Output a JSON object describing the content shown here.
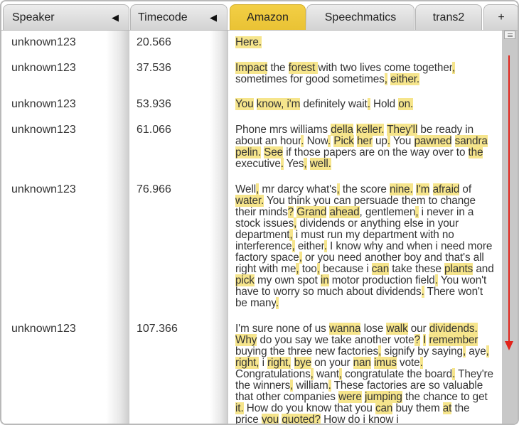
{
  "tabs": {
    "speaker": "Speaker",
    "sort_icon": "◀",
    "timecode": "Timecode",
    "amazon": "Amazon",
    "speechmatics": "Speechmatics",
    "trans2": "trans2",
    "add": "+"
  },
  "colors": {
    "active_tab": "#f0c93c",
    "highlight": "#f6e58c",
    "arrow": "#e2231a"
  },
  "rows": [
    {
      "speaker": "unknown123",
      "time": "20.566"
    },
    {
      "speaker": "unknown123",
      "time": "37.536"
    },
    {
      "speaker": "unknown123",
      "time": "53.936"
    },
    {
      "speaker": "unknown123",
      "time": "61.066"
    },
    {
      "speaker": "unknown123",
      "time": "76.966"
    },
    {
      "speaker": "unknown123",
      "time": "107.366"
    }
  ],
  "transcripts": [
    "Here.",
    "Impact the forest with two lives come together, sometimes for good sometimes, either.",
    "You know, i'm definitely wait. Hold on.",
    "Phone mrs williams della keller. They'll be ready in about an hour. Now. Pick her up. You pawned sandra pelin. See if those papers are on the way over to the executive. Yes, well.",
    "Well, mr darcy what's, the score nine. I'm afraid of water. You think you can persuade them to change their minds? Grand ahead, gentlemen, i never in a stock issues, dividends or anything else in your department, i must run my department with no interference, either. I know why and when i need more factory space, or you need another boy and that's all right with me, too, because i can take these plants and pick my own spot in motor production field. You won't have to worry so much about dividends. There won't be many.",
    "I'm sure none of us wanna lose walk our dividends. Why do you say we take another vote? I remember buying the three new factories, signify by saying, aye, right, i right, bye on your nan imus vote. Congratulations, want, congratulate the board. They're the winners, william. These factories are so valuable that other companies were jumping the chance to get it. How do you know that you can buy them at the price you quoted? How do i know i"
  ],
  "transcript_words": [
    [
      {
        "t": "Here.",
        "h": true
      }
    ],
    [
      {
        "t": "Impact",
        "h": true
      },
      {
        "t": " the "
      },
      {
        "t": "forest ",
        "h": true
      },
      {
        "t": " with two lives come together"
      },
      {
        "t": ",",
        "h": true
      },
      {
        "t": " sometimes for good sometimes"
      },
      {
        "t": ",",
        "h": true
      },
      {
        "t": " "
      },
      {
        "t": "either.",
        "h": true
      }
    ],
    [
      {
        "t": "You",
        "h": true
      },
      {
        "t": " "
      },
      {
        "t": "know",
        "h": true
      },
      {
        "t": ", ",
        "h": true
      },
      {
        "t": "i'm",
        "h": true
      },
      {
        "t": " definitely wait"
      },
      {
        "t": ".",
        "h": true
      },
      {
        "t": " Hold "
      },
      {
        "t": "on.",
        "h": true
      }
    ],
    [
      {
        "t": "Phone mrs williams "
      },
      {
        "t": "della",
        "h": true
      },
      {
        "t": " "
      },
      {
        "t": "keller.",
        "h": true
      },
      {
        "t": " "
      },
      {
        "t": "They'll",
        "h": true
      },
      {
        "t": " be ready in about an hour"
      },
      {
        "t": ".",
        "h": true
      },
      {
        "t": " Now"
      },
      {
        "t": ".",
        "h": true
      },
      {
        "t": " "
      },
      {
        "t": "Pick",
        "h": true
      },
      {
        "t": " "
      },
      {
        "t": "her",
        "h": true
      },
      {
        "t": " up"
      },
      {
        "t": ".",
        "h": true
      },
      {
        "t": " You "
      },
      {
        "t": "pawned",
        "h": true
      },
      {
        "t": " "
      },
      {
        "t": "sandra",
        "h": true
      },
      {
        "t": " "
      },
      {
        "t": "pelin.",
        "h": true
      },
      {
        "t": " "
      },
      {
        "t": "See",
        "h": true
      },
      {
        "t": " if those papers are on the way over to "
      },
      {
        "t": "the",
        "h": true
      },
      {
        "t": " executive"
      },
      {
        "t": ".",
        "h": true
      },
      {
        "t": " Yes"
      },
      {
        "t": ",",
        "h": true
      },
      {
        "t": " "
      },
      {
        "t": "well.",
        "h": true
      }
    ],
    [
      {
        "t": "Well"
      },
      {
        "t": ",",
        "h": true
      },
      {
        "t": " mr darcy what's"
      },
      {
        "t": ",",
        "h": true
      },
      {
        "t": " the score "
      },
      {
        "t": "nine.",
        "h": true
      },
      {
        "t": " "
      },
      {
        "t": "I'm",
        "h": true
      },
      {
        "t": " "
      },
      {
        "t": "afraid",
        "h": true
      },
      {
        "t": " of "
      },
      {
        "t": "water.",
        "h": true
      },
      {
        "t": " You think you can persuade them to change their minds"
      },
      {
        "t": "?",
        "h": true
      },
      {
        "t": " "
      },
      {
        "t": "Grand",
        "h": true
      },
      {
        "t": " "
      },
      {
        "t": "ahead",
        "h": true
      },
      {
        "t": ", gentlemen"
      },
      {
        "t": ",",
        "h": true
      },
      {
        "t": " i never in a stock issues"
      },
      {
        "t": ",",
        "h": true
      },
      {
        "t": " dividends or anything else in your department"
      },
      {
        "t": ",",
        "h": true
      },
      {
        "t": " i must run my department with no interference"
      },
      {
        "t": ",",
        "h": true
      },
      {
        "t": " either"
      },
      {
        "t": ".",
        "h": true
      },
      {
        "t": " I know why and when i need more factory space"
      },
      {
        "t": ",",
        "h": true
      },
      {
        "t": " or you need another boy and that's all right with me"
      },
      {
        "t": ",",
        "h": true
      },
      {
        "t": " too"
      },
      {
        "t": ",",
        "h": true
      },
      {
        "t": " because i "
      },
      {
        "t": "can",
        "h": true
      },
      {
        "t": " take these "
      },
      {
        "t": "plants",
        "h": true
      },
      {
        "t": " and "
      },
      {
        "t": "pick",
        "h": true
      },
      {
        "t": " my own spot "
      },
      {
        "t": "in",
        "h": true
      },
      {
        "t": " motor production field"
      },
      {
        "t": ".",
        "h": true
      },
      {
        "t": " You won't have to worry so much about dividends"
      },
      {
        "t": ".",
        "h": true
      },
      {
        "t": " There won't be many"
      },
      {
        "t": ".",
        "h": true
      }
    ],
    [
      {
        "t": "I'm sure none of us "
      },
      {
        "t": "wanna",
        "h": true
      },
      {
        "t": " lose "
      },
      {
        "t": "walk",
        "h": true
      },
      {
        "t": " our "
      },
      {
        "t": "dividends.",
        "h": true
      },
      {
        "t": " "
      },
      {
        "t": "Why",
        "h": true
      },
      {
        "t": " do you say we take another vote"
      },
      {
        "t": "?",
        "h": true
      },
      {
        "t": " "
      },
      {
        "t": "I",
        "h": true
      },
      {
        "t": " "
      },
      {
        "t": "remember",
        "h": true
      },
      {
        "t": " buying the three new factories"
      },
      {
        "t": ",",
        "h": true
      },
      {
        "t": " signify by saying"
      },
      {
        "t": ",",
        "h": true
      },
      {
        "t": " aye"
      },
      {
        "t": ",",
        "h": true
      },
      {
        "t": " "
      },
      {
        "t": "right,",
        "h": true
      },
      {
        "t": " i "
      },
      {
        "t": "right,",
        "h": true
      },
      {
        "t": " "
      },
      {
        "t": "bye",
        "h": true
      },
      {
        "t": " on your "
      },
      {
        "t": "nan",
        "h": true
      },
      {
        "t": " "
      },
      {
        "t": "imus",
        "h": true
      },
      {
        "t": " vote"
      },
      {
        "t": ".",
        "h": true
      },
      {
        "t": " Congratulations"
      },
      {
        "t": ",",
        "h": true
      },
      {
        "t": " want"
      },
      {
        "t": ",",
        "h": true
      },
      {
        "t": " congratulate the board"
      },
      {
        "t": ".",
        "h": true
      },
      {
        "t": " They're the winners"
      },
      {
        "t": ",",
        "h": true
      },
      {
        "t": " william"
      },
      {
        "t": ".",
        "h": true
      },
      {
        "t": " These factories are so valuable that other companies "
      },
      {
        "t": "were",
        "h": true
      },
      {
        "t": " "
      },
      {
        "t": "jumping",
        "h": true
      },
      {
        "t": " the chance to get "
      },
      {
        "t": "it.",
        "h": true
      },
      {
        "t": " How do you know that you "
      },
      {
        "t": "can",
        "h": true
      },
      {
        "t": " buy them "
      },
      {
        "t": "at",
        "h": true
      },
      {
        "t": " the price "
      },
      {
        "t": "you",
        "h": true
      },
      {
        "t": " "
      },
      {
        "t": "quoted?",
        "h": true
      },
      {
        "t": " How do i know i"
      }
    ]
  ]
}
